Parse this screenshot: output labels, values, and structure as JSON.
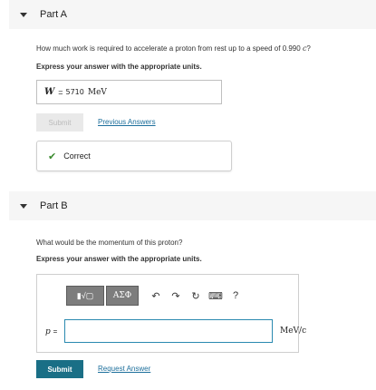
{
  "partA": {
    "title": "Part A",
    "question_before": "How much work is required to accelerate a proton from rest up to a speed of 0.990 ",
    "question_var": "c",
    "question_after": "?",
    "instruction": "Express your answer with the appropriate units.",
    "answer": {
      "variable": "W",
      "equals": "=",
      "value": "5710",
      "unit": "MeV"
    },
    "submit_label": "Submit",
    "previous_answers_label": "Previous Answers",
    "feedback": "Correct"
  },
  "partB": {
    "title": "Part B",
    "question": "What would be the momentum of this proton?",
    "instruction": "Express your answer with the appropriate units.",
    "toolbar": {
      "templates_label": "▮√▢",
      "symbols_label": "ΑΣΦ",
      "undo_glyph": "↶",
      "redo_glyph": "↷",
      "reset_glyph": "↻",
      "keyboard_glyph": "⌨",
      "help_glyph": "?"
    },
    "input": {
      "variable": "p",
      "equals": "=",
      "value": "",
      "unit": "MeV/c"
    },
    "submit_label": "Submit",
    "request_answer_label": "Request Answer"
  },
  "colors": {
    "accent": "#1a6f86",
    "link": "#1d6f9c",
    "correct": "#3a8a2e",
    "header_bg": "#f6f6f6"
  }
}
